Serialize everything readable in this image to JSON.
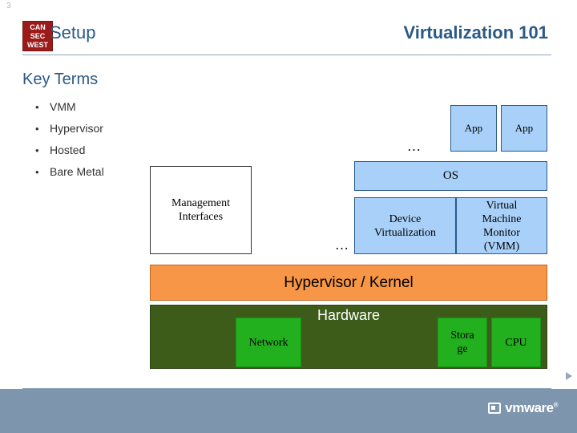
{
  "slide": {
    "number": "3",
    "logo_lines": [
      "CAN",
      "SEC",
      "WEST"
    ],
    "title_left": "Setup",
    "title_right": "Virtualization 101"
  },
  "key_terms": {
    "heading": "Key Terms",
    "items": [
      {
        "label": "VMM"
      },
      {
        "label": "Hypervisor"
      },
      {
        "label": "Hosted"
      },
      {
        "label": "Bare Metal"
      }
    ]
  },
  "diagram": {
    "app1": "App",
    "app2": "App",
    "apps_ellipsis": "…",
    "os": "OS",
    "management_interfaces": "Management\nInterfaces",
    "mgmt_ellipsis": "…",
    "device_virtualization": "Device\nVirtualization",
    "vmm": "Virtual\nMachine\nMonitor\n(VMM)",
    "hypervisor_kernel": "Hypervisor / Kernel",
    "hardware": "Hardware",
    "network": "Network",
    "storage": "Stora\nge",
    "cpu": "CPU",
    "colors": {
      "blue_fill": "#a8d0f8",
      "blue_border": "#2a5a86",
      "orange_fill": "#f79646",
      "dark_green_fill": "#3d5c1a",
      "green_fill": "#22b01e",
      "white_fill": "#ffffff"
    }
  },
  "footer": {
    "brand": "vmware",
    "brand_reg": "®"
  }
}
